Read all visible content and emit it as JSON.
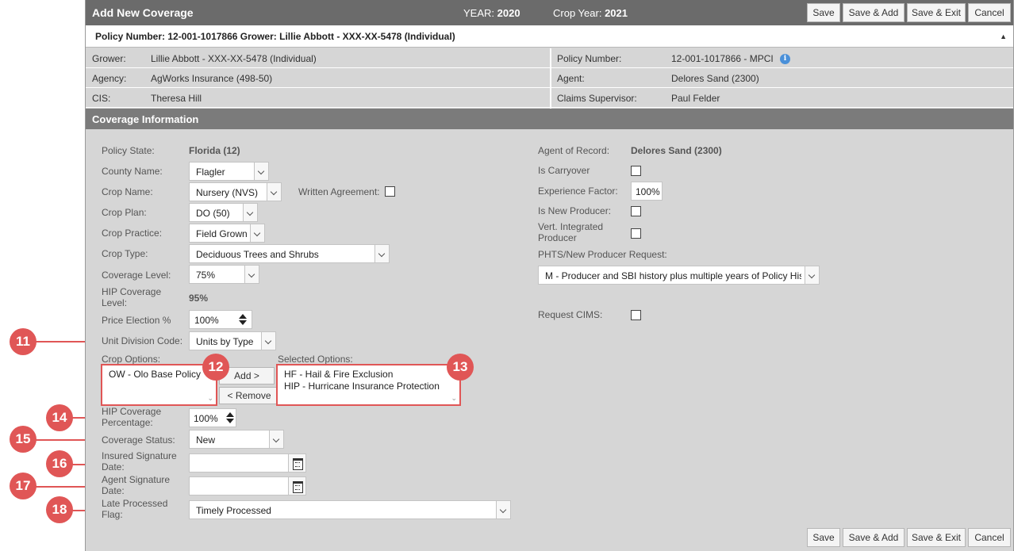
{
  "header": {
    "title": "Add New Coverage",
    "year_label": "YEAR:",
    "year_value": "2020",
    "crop_year_label": "Crop Year:",
    "crop_year_value": "2021"
  },
  "actions": {
    "save": "Save",
    "save_add": "Save & Add",
    "save_exit": "Save & Exit",
    "cancel": "Cancel"
  },
  "policy_bar": {
    "text": "Policy Number: 12-001-1017866 Grower: Lillie Abbott - XXX-XX-5478 (Individual)",
    "collapse_glyph": "▲"
  },
  "info": {
    "grower_label": "Grower:",
    "grower_value": "Lillie Abbott - XXX-XX-5478 (Individual)",
    "agency_label": "Agency:",
    "agency_value": "AgWorks Insurance (498-50)",
    "cis_label": "CIS:",
    "cis_value": "Theresa Hill",
    "policy_number_label": "Policy Number:",
    "policy_number_value": "12-001-1017866 - MPCI",
    "info_glyph": "i",
    "agent_label": "Agent:",
    "agent_value": "Delores Sand (2300)",
    "claims_label": "Claims Supervisor:",
    "claims_value": "Paul Felder"
  },
  "section": {
    "title": "Coverage Information"
  },
  "form": {
    "policy_state_label": "Policy State:",
    "policy_state_value": "Florida (12)",
    "county_label": "County Name:",
    "county_value": "Flagler",
    "crop_name_label": "Crop Name:",
    "crop_name_value": "Nursery (NVS)",
    "written_agreement_label": "Written Agreement:",
    "crop_plan_label": "Crop Plan:",
    "crop_plan_value": "DO (50)",
    "crop_practice_label": "Crop Practice:",
    "crop_practice_value": "Field Grown",
    "crop_type_label": "Crop Type:",
    "crop_type_value": "Deciduous Trees and Shrubs",
    "coverage_level_label": "Coverage Level:",
    "coverage_level_value": "75%",
    "hip_coverage_level_label": "HIP Coverage Level:",
    "hip_coverage_level_value": "95%",
    "price_election_label": "Price Election %",
    "price_election_value": "100%",
    "unit_division_label": "Unit Division Code:",
    "unit_division_value": "Units by Type",
    "crop_options_label": "Crop Options:",
    "crop_options": [
      "OW - Olo Base Policy"
    ],
    "add_label": "Add >",
    "remove_label": "< Remove",
    "selected_options_label": "Selected Options:",
    "selected_options": [
      "HF - Hail & Fire Exclusion",
      "HIP - Hurricane Insurance Protection"
    ],
    "hip_pct_label": "HIP Coverage Percentage:",
    "hip_pct_value": "100%",
    "coverage_status_label": "Coverage Status:",
    "coverage_status_value": "New",
    "insured_sig_label": "Insured Signature Date:",
    "agent_sig_label": "Agent Signature Date:",
    "late_processed_label": "Late Processed Flag:",
    "late_processed_value": "Timely Processed",
    "agent_of_record_label": "Agent of Record:",
    "agent_of_record_value": "Delores Sand (2300)",
    "is_carryover_label": "Is Carryover",
    "experience_factor_label": "Experience Factor:",
    "experience_factor_value": "100%",
    "is_new_producer_label": "Is New Producer:",
    "vert_integrated_label": "Vert. Integrated Producer",
    "phts_label": "PHTS/New Producer Request:",
    "phts_value": "M - Producer and SBI history plus multiple years of Policy History",
    "request_cims_label": "Request CIMS:"
  },
  "callouts": {
    "c11": "11",
    "c12": "12",
    "c13": "13",
    "c14": "14",
    "c15": "15",
    "c16": "16",
    "c17": "17",
    "c18": "18"
  },
  "colors": {
    "callout": "#e05656",
    "title_bar": "#6b6b6b",
    "section_bar": "#7b7b7b",
    "panel": "#d6d6d6"
  }
}
